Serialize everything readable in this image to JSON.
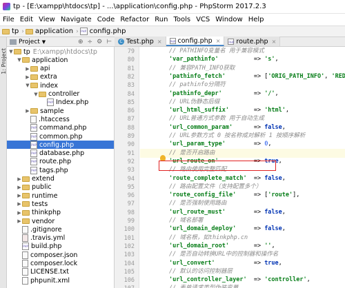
{
  "window": {
    "title": "tp - [E:\\xampp\\htdocs\\tp] - ...\\application\\config.php - PhpStorm 2017.2.3"
  },
  "menu": [
    "File",
    "Edit",
    "View",
    "Navigate",
    "Code",
    "Refactor",
    "Run",
    "Tools",
    "VCS",
    "Window",
    "Help"
  ],
  "breadcrumb": [
    "tp",
    "application",
    "config.php"
  ],
  "project_panel": {
    "title": "Project",
    "side_tab": "1: Project"
  },
  "tree": [
    {
      "label": "tp",
      "path": "E:\\xampp\\htdocs\\tp",
      "type": "folder",
      "arrow": "▼"
    },
    {
      "label": "application",
      "type": "folder",
      "arrow": "▼"
    },
    {
      "label": "api",
      "type": "folder",
      "arrow": "▶"
    },
    {
      "label": "extra",
      "type": "folder",
      "arrow": "▶"
    },
    {
      "label": "index",
      "type": "folder",
      "arrow": "▼"
    },
    {
      "label": "controller",
      "type": "folder",
      "arrow": "▼"
    },
    {
      "label": "Index.php",
      "type": "php",
      "arrow": ""
    },
    {
      "label": "sample",
      "type": "folder",
      "arrow": "▶"
    },
    {
      "label": ".htaccess",
      "type": "file",
      "arrow": ""
    },
    {
      "label": "command.php",
      "type": "php",
      "arrow": ""
    },
    {
      "label": "common.php",
      "type": "php",
      "arrow": ""
    },
    {
      "label": "config.php",
      "type": "php",
      "arrow": "",
      "selected": true
    },
    {
      "label": "database.php",
      "type": "php",
      "arrow": ""
    },
    {
      "label": "route.php",
      "type": "php",
      "arrow": ""
    },
    {
      "label": "tags.php",
      "type": "php",
      "arrow": ""
    },
    {
      "label": "extend",
      "type": "folder",
      "arrow": "▶"
    },
    {
      "label": "public",
      "type": "folder",
      "arrow": "▶"
    },
    {
      "label": "runtime",
      "type": "folder",
      "arrow": "▶"
    },
    {
      "label": "tests",
      "type": "folder",
      "arrow": "▶"
    },
    {
      "label": "thinkphp",
      "type": "folder",
      "arrow": "▶"
    },
    {
      "label": "vendor",
      "type": "folder",
      "arrow": "▶"
    },
    {
      "label": ".gitignore",
      "type": "file",
      "arrow": ""
    },
    {
      "label": ".travis.yml",
      "type": "yml",
      "arrow": ""
    },
    {
      "label": "build.php",
      "type": "php",
      "arrow": ""
    },
    {
      "label": "composer.json",
      "type": "file",
      "arrow": ""
    },
    {
      "label": "composer.lock",
      "type": "file",
      "arrow": ""
    },
    {
      "label": "LICENSE.txt",
      "type": "file",
      "arrow": ""
    },
    {
      "label": "phpunit.xml",
      "type": "file",
      "arrow": ""
    }
  ],
  "tabs": [
    {
      "label": "Test.php",
      "icon": "c"
    },
    {
      "label": "config.php",
      "icon": "p",
      "active": true
    },
    {
      "label": "route.php",
      "icon": "p"
    }
  ],
  "code": [
    {
      "n": "79",
      "parts": [
        {
          "t": "cm",
          "v": "// PATHINFO变量名 用于兼容模式"
        }
      ]
    },
    {
      "n": "80",
      "parts": [
        {
          "t": "str",
          "v": "'var_pathinfo'"
        },
        {
          "t": "op",
          "v": "          => "
        },
        {
          "t": "str",
          "v": "'s'"
        },
        {
          "t": "op",
          "v": ","
        }
      ]
    },
    {
      "n": "81",
      "parts": [
        {
          "t": "cm",
          "v": "// 兼容PATH_INFO获取"
        }
      ]
    },
    {
      "n": "82",
      "parts": [
        {
          "t": "str",
          "v": "'pathinfo_fetch'"
        },
        {
          "t": "op",
          "v": "        => ["
        },
        {
          "t": "str",
          "v": "'ORIG_PATH_INFO'"
        },
        {
          "t": "op",
          "v": ", "
        },
        {
          "t": "str",
          "v": "'REDIRECT_PATH_INFO'"
        }
      ]
    },
    {
      "n": "83",
      "parts": [
        {
          "t": "cm",
          "v": "// pathinfo分隔符"
        }
      ]
    },
    {
      "n": "84",
      "parts": [
        {
          "t": "str",
          "v": "'pathinfo_depr'"
        },
        {
          "t": "op",
          "v": "         => "
        },
        {
          "t": "str",
          "v": "'/'"
        },
        {
          "t": "op",
          "v": ","
        }
      ]
    },
    {
      "n": "85",
      "parts": [
        {
          "t": "cm",
          "v": "// URL伪静态后缀"
        }
      ]
    },
    {
      "n": "86",
      "parts": [
        {
          "t": "str",
          "v": "'url_html_suffix'"
        },
        {
          "t": "op",
          "v": "       => "
        },
        {
          "t": "str",
          "v": "'html'"
        },
        {
          "t": "op",
          "v": ","
        }
      ]
    },
    {
      "n": "87",
      "parts": [
        {
          "t": "cm",
          "v": "// URL普通方式参数 用于自动生成"
        }
      ]
    },
    {
      "n": "88",
      "parts": [
        {
          "t": "str",
          "v": "'url_common_param'"
        },
        {
          "t": "op",
          "v": "      => "
        },
        {
          "t": "kw",
          "v": "false"
        },
        {
          "t": "op",
          "v": ","
        }
      ]
    },
    {
      "n": "89",
      "parts": [
        {
          "t": "cm",
          "v": "// URL参数方式 0 按名称成对解析 1 按顺序解析"
        }
      ]
    },
    {
      "n": "90",
      "parts": [
        {
          "t": "str",
          "v": "'url_param_type'"
        },
        {
          "t": "op",
          "v": "        => "
        },
        {
          "t": "num",
          "v": "0"
        },
        {
          "t": "op",
          "v": ","
        }
      ]
    },
    {
      "n": "91",
      "parts": [
        {
          "t": "cm",
          "v": "// 是否开启路由"
        }
      ],
      "hl": true
    },
    {
      "n": "92",
      "parts": [
        {
          "t": "str",
          "v": "'url_route_on'"
        },
        {
          "t": "op",
          "v": "          => "
        },
        {
          "t": "kw",
          "v": "true"
        },
        {
          "t": "op",
          "v": ","
        }
      ]
    },
    {
      "n": "93",
      "parts": [
        {
          "t": "cm",
          "v": "// 路由使用完整匹配"
        }
      ]
    },
    {
      "n": "94",
      "parts": [
        {
          "t": "str",
          "v": "'route_complete_match'"
        },
        {
          "t": "op",
          "v": "  => "
        },
        {
          "t": "kw",
          "v": "false"
        },
        {
          "t": "op",
          "v": ","
        }
      ]
    },
    {
      "n": "95",
      "parts": [
        {
          "t": "cm",
          "v": "// 路由配置文件（支持配置多个）"
        }
      ]
    },
    {
      "n": "96",
      "parts": [
        {
          "t": "str",
          "v": "'route_config_file'"
        },
        {
          "t": "op",
          "v": "     => ["
        },
        {
          "t": "str",
          "v": "'route'"
        },
        {
          "t": "op",
          "v": "],"
        }
      ]
    },
    {
      "n": "97",
      "parts": [
        {
          "t": "cm",
          "v": "// 是否强制使用路由"
        }
      ]
    },
    {
      "n": "98",
      "parts": [
        {
          "t": "str",
          "v": "'url_route_must'"
        },
        {
          "t": "op",
          "v": "        => "
        },
        {
          "t": "kw",
          "v": "false"
        },
        {
          "t": "op",
          "v": ","
        }
      ]
    },
    {
      "n": "99",
      "parts": [
        {
          "t": "cm",
          "v": "// 域名部署"
        }
      ]
    },
    {
      "n": "100",
      "parts": [
        {
          "t": "str",
          "v": "'url_domain_deploy'"
        },
        {
          "t": "op",
          "v": "     => "
        },
        {
          "t": "kw",
          "v": "false"
        },
        {
          "t": "op",
          "v": ","
        }
      ]
    },
    {
      "n": "101",
      "parts": [
        {
          "t": "cm",
          "v": "// 域名根，如thinkphp.cn"
        }
      ]
    },
    {
      "n": "102",
      "parts": [
        {
          "t": "str",
          "v": "'url_domain_root'"
        },
        {
          "t": "op",
          "v": "       => "
        },
        {
          "t": "str",
          "v": "''"
        },
        {
          "t": "op",
          "v": ","
        }
      ]
    },
    {
      "n": "103",
      "parts": [
        {
          "t": "cm",
          "v": "// 是否自动转换URL中的控制器和操作名"
        }
      ]
    },
    {
      "n": "104",
      "parts": [
        {
          "t": "str",
          "v": "'url_convert'"
        },
        {
          "t": "op",
          "v": "           => "
        },
        {
          "t": "kw",
          "v": "true"
        },
        {
          "t": "op",
          "v": ","
        }
      ]
    },
    {
      "n": "105",
      "parts": [
        {
          "t": "cm",
          "v": "// 默认的访问控制器层"
        }
      ]
    },
    {
      "n": "106",
      "parts": [
        {
          "t": "str",
          "v": "'url_controller_layer'"
        },
        {
          "t": "op",
          "v": "  => "
        },
        {
          "t": "str",
          "v": "'controller'"
        },
        {
          "t": "op",
          "v": ","
        }
      ]
    },
    {
      "n": "107",
      "parts": [
        {
          "t": "cm",
          "v": "// 表单请求类型伪装变量"
        }
      ]
    }
  ]
}
